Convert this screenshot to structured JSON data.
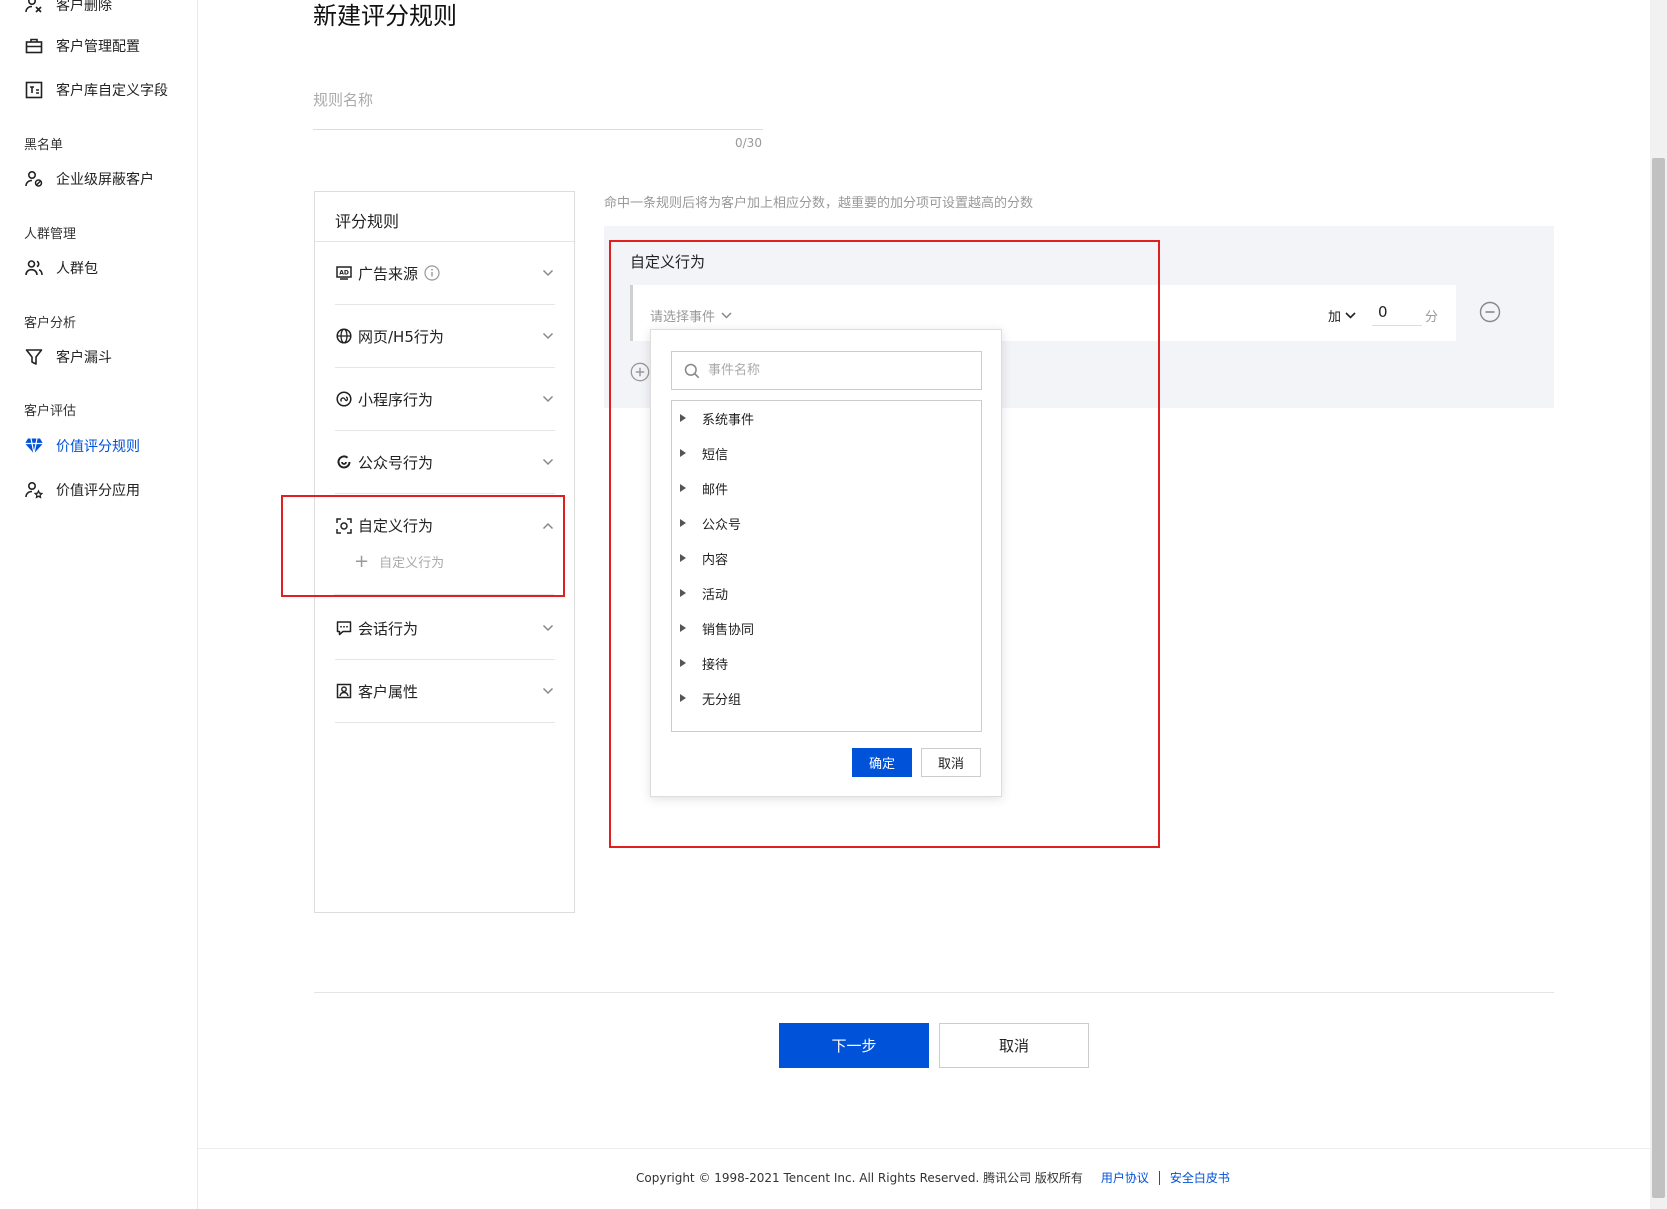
{
  "sidebar": {
    "items": [
      {
        "label": "客户删除",
        "icon": "user-remove-icon"
      },
      {
        "label": "客户管理配置",
        "icon": "briefcase-icon"
      },
      {
        "label": "客户库自定义字段",
        "icon": "custom-field-icon"
      },
      {
        "label": "企业级屏蔽客户",
        "icon": "user-block-icon"
      },
      {
        "label": "人群包",
        "icon": "users-icon"
      },
      {
        "label": "客户漏斗",
        "icon": "funnel-icon"
      },
      {
        "label": "价值评分规则",
        "icon": "diamond-icon",
        "active": true
      },
      {
        "label": "价值评分应用",
        "icon": "user-score-icon"
      }
    ],
    "groups": [
      "黑名单",
      "人群管理",
      "客户分析",
      "客户评估"
    ]
  },
  "main": {
    "title": "新建评分规则",
    "name_placeholder": "规则名称",
    "name_counter": "0/30",
    "hint": "命中一条规则后将为客户加上相应分数，越重要的加分项可设置越高的分数"
  },
  "rule_panel": {
    "title": "评分规则",
    "categories": [
      {
        "label": "广告来源",
        "icon": "ad-icon",
        "has_info": true,
        "expanded": false
      },
      {
        "label": "网页/H5行为",
        "icon": "globe-icon",
        "expanded": false
      },
      {
        "label": "小程序行为",
        "icon": "miniprogram-icon",
        "expanded": false
      },
      {
        "label": "公众号行为",
        "icon": "official-account-icon",
        "expanded": false
      },
      {
        "label": "自定义行为",
        "icon": "custom-behavior-icon",
        "expanded": true
      },
      {
        "label": "会话行为",
        "icon": "chat-icon",
        "expanded": false
      },
      {
        "label": "客户属性",
        "icon": "profile-icon",
        "expanded": false
      }
    ],
    "sub_item": "自定义行为"
  },
  "editor": {
    "section_title": "自定义行为",
    "event_placeholder": "请选择事件",
    "operator": "加",
    "score": "0",
    "score_unit": "分"
  },
  "popover": {
    "search_placeholder": "事件名称",
    "tree": [
      "系统事件",
      "短信",
      "邮件",
      "公众号",
      "内容",
      "活动",
      "销售协同",
      "接待",
      "无分组"
    ],
    "ok": "确定",
    "cancel": "取消"
  },
  "actions": {
    "next": "下一步",
    "cancel": "取消"
  },
  "footer": {
    "copyright": "Copyright © 1998-2021 Tencent Inc. All Rights Reserved. 腾讯公司 版权所有",
    "link1": "用户协议",
    "link2": "安全白皮书"
  },
  "colors": {
    "primary": "#0052d9",
    "highlight": "#e02020"
  }
}
